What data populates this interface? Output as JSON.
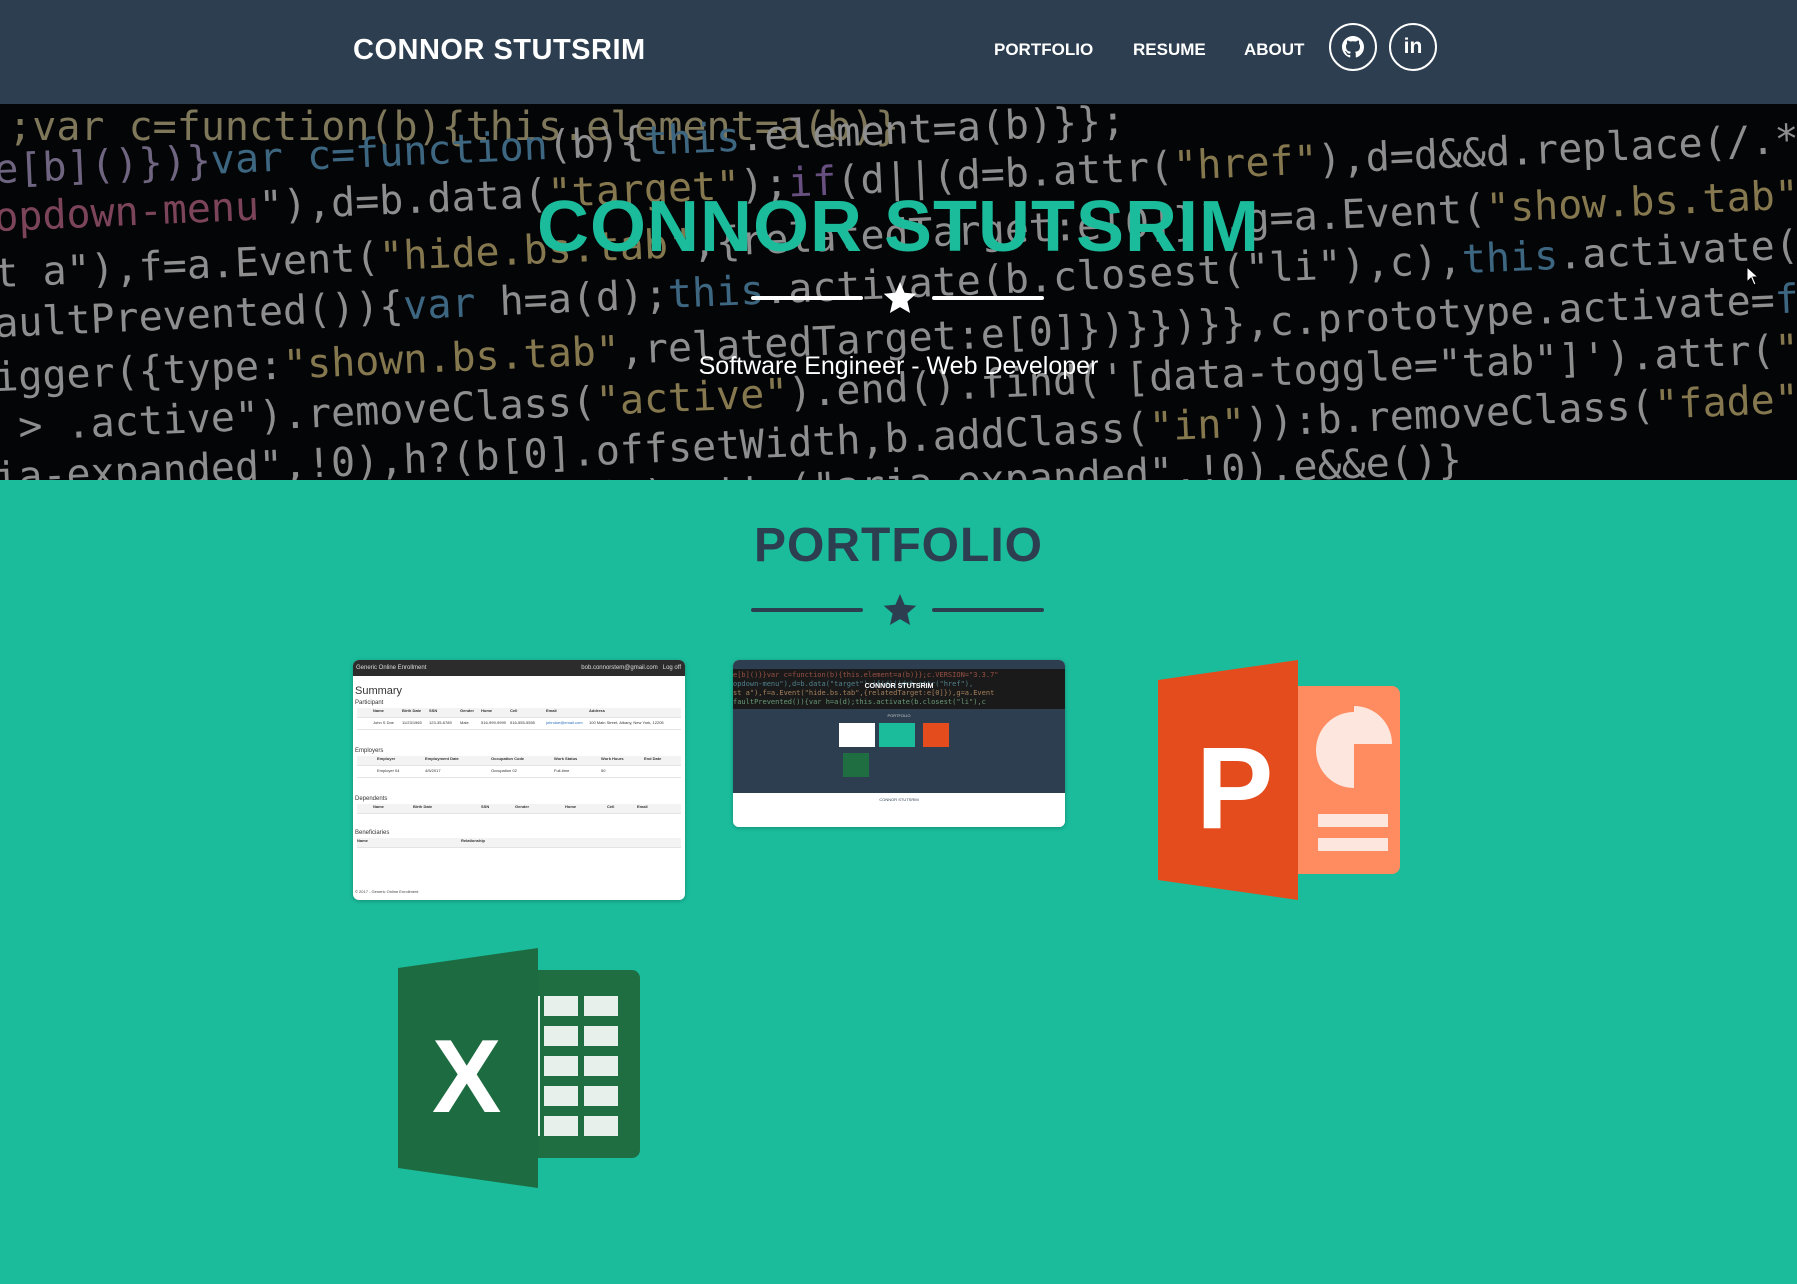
{
  "navbar": {
    "brand": "CONNOR STUTSRIM",
    "links": [
      "PORTFOLIO",
      "RESUME",
      "ABOUT"
    ],
    "social": [
      {
        "name": "github",
        "icon": "github-icon"
      },
      {
        "name": "linkedin",
        "icon": "linkedin-icon",
        "text": "in"
      }
    ]
  },
  "masthead": {
    "title": "CONNOR STUTSRIM",
    "subtitle": "Software Engineer - Web Developer",
    "divider_icon": "star-icon"
  },
  "portfolio": {
    "heading": "PORTFOLIO",
    "divider_icon": "star-icon",
    "items": [
      {
        "name": "Generic Online Enrollment",
        "icon": "enrollment-app-screenshot"
      },
      {
        "name": "Connor Stutsrim site",
        "icon": "portfolio-site-screenshot"
      },
      {
        "name": "PowerPoint",
        "icon": "powerpoint-icon",
        "letter": "P"
      },
      {
        "name": "Excel",
        "icon": "excel-icon",
        "letter": "X"
      }
    ],
    "thumb_enrollment": {
      "app_title": "Generic Online Enrollment",
      "user": "bob.connorstem@gmail.com",
      "logout": "Log off",
      "heading": "Summary",
      "sections": [
        "Participant",
        "Employers",
        "Dependents",
        "Beneficiaries"
      ],
      "participant_headers": [
        "Name",
        "Birth Date",
        "SSN",
        "Gender",
        "Home",
        "Cell",
        "Email",
        "Address"
      ],
      "participant_row": [
        "John S Doe",
        "11/23/1965",
        "123-35-6789",
        "Male",
        "516-999-9999",
        "516-555-5555",
        "johndoe@email.com",
        "100 Main Street, Albany, New York, 12205"
      ],
      "employer_headers": [
        "Employer",
        "Employment Date",
        "Occupation Code",
        "Work Status",
        "Work Hours",
        "End Date"
      ],
      "employer_row": [
        "Employer 04",
        "4/5/2017",
        "Occupation 02",
        "Full-time",
        "50",
        ""
      ],
      "dependent_headers": [
        "Name",
        "Birth Date",
        "SSN",
        "Gender",
        "Home",
        "Cell",
        "Email"
      ],
      "beneficiary_headers": [
        "Name",
        "Relationship"
      ],
      "footer": "© 2017 - Generic Online Enrollment"
    },
    "thumb_site": {
      "title": "CONNOR STUTSRIM",
      "section": "PORTFOLIO",
      "footer_name": "CONNOR STUTSRIM"
    }
  },
  "colors": {
    "navy": "#2c3e50",
    "teal": "#1abc9c",
    "white": "#ffffff",
    "ppt_dark": "#e44c1d",
    "ppt_light": "#ff8b60",
    "excel_dark": "#1e6e42",
    "excel_light": "#e7f0ea"
  }
}
